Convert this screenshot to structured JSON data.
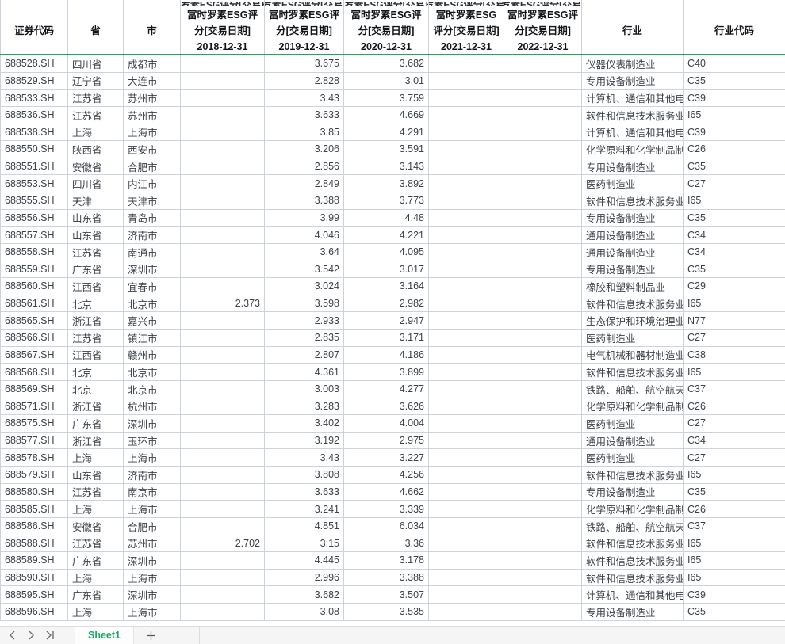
{
  "table": {
    "columns": [
      {
        "label": "证券代码"
      },
      {
        "label": "省"
      },
      {
        "label": "市"
      },
      {
        "label": "富时罗素ESG评分[交易日期]",
        "date": "2018-12-31"
      },
      {
        "label": "富时罗素ESG评分[交易日期]",
        "date": "2019-12-31"
      },
      {
        "label": "富时罗素ESG评分[交易日期]",
        "date": "2020-12-31"
      },
      {
        "label": "富时罗素ESG评分[交易日期]",
        "date": "2021-12-31"
      },
      {
        "label": "富时罗素ESG评分[交易日期]",
        "date": "2022-12-31"
      },
      {
        "label": "行业"
      },
      {
        "label": "行业代码"
      }
    ],
    "rows": [
      [
        "688528.SH",
        "四川省",
        "成都市",
        "",
        "3.675",
        "3.682",
        "",
        "",
        "仪器仪表制造业",
        "C40"
      ],
      [
        "688529.SH",
        "辽宁省",
        "大连市",
        "",
        "2.828",
        "3.01",
        "",
        "",
        "专用设备制造业",
        "C35"
      ],
      [
        "688533.SH",
        "江苏省",
        "苏州市",
        "",
        "3.43",
        "3.759",
        "",
        "",
        "计算机、通信和其他电子设备制造业",
        "C39"
      ],
      [
        "688536.SH",
        "江苏省",
        "苏州市",
        "",
        "3.633",
        "4.669",
        "",
        "",
        "软件和信息技术服务业",
        "I65"
      ],
      [
        "688538.SH",
        "上海",
        "上海市",
        "",
        "3.85",
        "4.291",
        "",
        "",
        "计算机、通信和其他电子设备制造业",
        "C39"
      ],
      [
        "688550.SH",
        "陕西省",
        "西安市",
        "",
        "3.206",
        "3.591",
        "",
        "",
        "化学原料和化学制品制造业",
        "C26"
      ],
      [
        "688551.SH",
        "安徽省",
        "合肥市",
        "",
        "2.856",
        "3.143",
        "",
        "",
        "专用设备制造业",
        "C35"
      ],
      [
        "688553.SH",
        "四川省",
        "内江市",
        "",
        "2.849",
        "3.892",
        "",
        "",
        "医药制造业",
        "C27"
      ],
      [
        "688555.SH",
        "天津",
        "天津市",
        "",
        "3.388",
        "3.773",
        "",
        "",
        "软件和信息技术服务业",
        "I65"
      ],
      [
        "688556.SH",
        "山东省",
        "青岛市",
        "",
        "3.99",
        "4.48",
        "",
        "",
        "专用设备制造业",
        "C35"
      ],
      [
        "688557.SH",
        "山东省",
        "济南市",
        "",
        "4.046",
        "4.221",
        "",
        "",
        "通用设备制造业",
        "C34"
      ],
      [
        "688558.SH",
        "江苏省",
        "南通市",
        "",
        "3.64",
        "4.095",
        "",
        "",
        "通用设备制造业",
        "C34"
      ],
      [
        "688559.SH",
        "广东省",
        "深圳市",
        "",
        "3.542",
        "3.017",
        "",
        "",
        "专用设备制造业",
        "C35"
      ],
      [
        "688560.SH",
        "江西省",
        "宜春市",
        "",
        "3.024",
        "3.164",
        "",
        "",
        "橡胶和塑料制品业",
        "C29"
      ],
      [
        "688561.SH",
        "北京",
        "北京市",
        "2.373",
        "3.598",
        "2.982",
        "",
        "",
        "软件和信息技术服务业",
        "I65"
      ],
      [
        "688565.SH",
        "浙江省",
        "嘉兴市",
        "",
        "2.933",
        "2.947",
        "",
        "",
        "生态保护和环境治理业",
        "N77"
      ],
      [
        "688566.SH",
        "江苏省",
        "镇江市",
        "",
        "2.835",
        "3.171",
        "",
        "",
        "医药制造业",
        "C27"
      ],
      [
        "688567.SH",
        "江西省",
        "赣州市",
        "",
        "2.807",
        "4.186",
        "",
        "",
        "电气机械和器材制造业",
        "C38"
      ],
      [
        "688568.SH",
        "北京",
        "北京市",
        "",
        "4.361",
        "3.899",
        "",
        "",
        "软件和信息技术服务业",
        "I65"
      ],
      [
        "688569.SH",
        "北京",
        "北京市",
        "",
        "3.003",
        "4.277",
        "",
        "",
        "铁路、船舶、航空航天和其他运输设备制造业",
        "C37"
      ],
      [
        "688571.SH",
        "浙江省",
        "杭州市",
        "",
        "3.283",
        "3.626",
        "",
        "",
        "化学原料和化学制品制造业",
        "C26"
      ],
      [
        "688575.SH",
        "广东省",
        "深圳市",
        "",
        "3.402",
        "4.004",
        "",
        "",
        "医药制造业",
        "C27"
      ],
      [
        "688577.SH",
        "浙江省",
        "玉环市",
        "",
        "3.192",
        "2.975",
        "",
        "",
        "通用设备制造业",
        "C34"
      ],
      [
        "688578.SH",
        "上海",
        "上海市",
        "",
        "3.43",
        "3.227",
        "",
        "",
        "医药制造业",
        "C27"
      ],
      [
        "688579.SH",
        "山东省",
        "济南市",
        "",
        "3.808",
        "4.256",
        "",
        "",
        "软件和信息技术服务业",
        "I65"
      ],
      [
        "688580.SH",
        "江苏省",
        "南京市",
        "",
        "3.633",
        "4.662",
        "",
        "",
        "专用设备制造业",
        "C35"
      ],
      [
        "688585.SH",
        "上海",
        "上海市",
        "",
        "3.241",
        "3.339",
        "",
        "",
        "化学原料和化学制品制造业",
        "C26"
      ],
      [
        "688586.SH",
        "安徽省",
        "合肥市",
        "",
        "4.851",
        "6.034",
        "",
        "",
        "铁路、船舶、航空航天和其他运输设备制造业",
        "C37"
      ],
      [
        "688588.SH",
        "江苏省",
        "苏州市",
        "2.702",
        "3.15",
        "3.36",
        "",
        "",
        "软件和信息技术服务业",
        "I65"
      ],
      [
        "688589.SH",
        "广东省",
        "深圳市",
        "",
        "4.445",
        "3.178",
        "",
        "",
        "软件和信息技术服务业",
        "I65"
      ],
      [
        "688590.SH",
        "上海",
        "上海市",
        "",
        "2.996",
        "3.388",
        "",
        "",
        "软件和信息技术服务业",
        "I65"
      ],
      [
        "688595.SH",
        "广东省",
        "深圳市",
        "",
        "3.682",
        "3.507",
        "",
        "",
        "计算机、通信和其他电子设备制造业",
        "C39"
      ],
      [
        "688596.SH",
        "上海",
        "上海市",
        "",
        "3.08",
        "3.535",
        "",
        "",
        "专用设备制造业",
        "C35"
      ]
    ]
  },
  "sheet_bar": {
    "active_sheet": "Sheet1",
    "icons": {
      "prev": "chevron-left-icon",
      "next": "chevron-right-icon",
      "last": "chevron-right-bar-icon",
      "add": "plus-icon"
    }
  },
  "colors": {
    "accent_green": "#21a567",
    "grid_line": "#ccd3de",
    "sheet_bar_bg": "#f5f5f6"
  }
}
